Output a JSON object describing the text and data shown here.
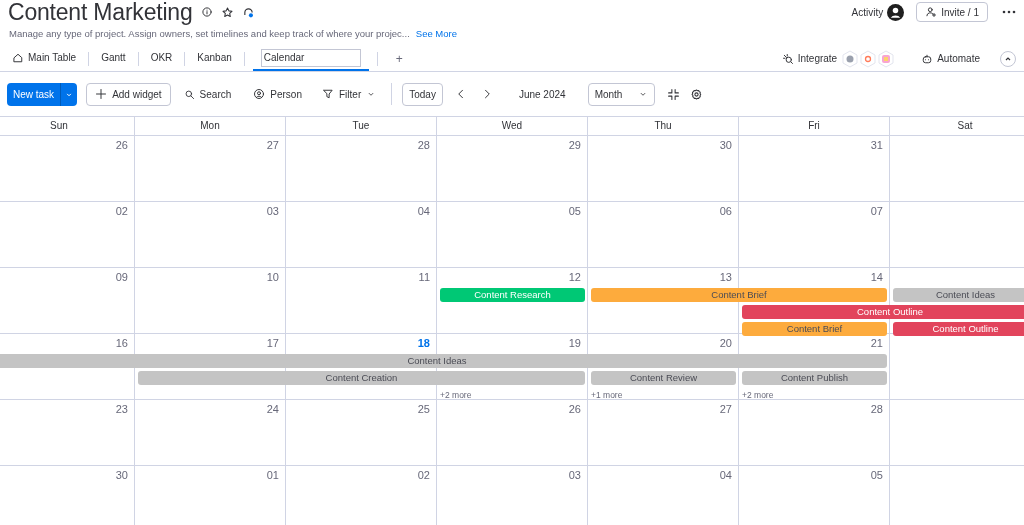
{
  "board": {
    "title": "Content Marketing",
    "description": "Manage any type of project. Assign owners, set timelines and keep track of where your projec...",
    "see_more": "See More",
    "activity": "Activity",
    "invite": "Invite / 1"
  },
  "views": [
    {
      "label": "Main Table",
      "selected": false
    },
    {
      "label": "Gantt",
      "selected": false
    },
    {
      "label": "OKR",
      "selected": false
    },
    {
      "label": "Kanban",
      "selected": false
    },
    {
      "label": "Calendar",
      "selected": true
    }
  ],
  "add_view": "+",
  "apps": {
    "integrate": "Integrate",
    "automate": "Automate"
  },
  "toolbar": {
    "new_task": "New task",
    "add_widget": "Add widget",
    "search": "Search",
    "person": "Person",
    "filter": "Filter",
    "today": "Today",
    "period": "June 2024",
    "view_mode": "Month"
  },
  "calendar": {
    "weekdays": [
      "Sun",
      "Mon",
      "Tue",
      "Wed",
      "Thu",
      "Fri",
      "Sat"
    ],
    "weeks": [
      {
        "days": [
          {
            "date": "26",
            "today": false
          },
          {
            "date": "27",
            "today": false
          },
          {
            "date": "28",
            "today": false
          },
          {
            "date": "29",
            "today": false
          },
          {
            "date": "30",
            "today": false
          },
          {
            "date": "31",
            "today": false
          }
        ]
      },
      {
        "days": [
          {
            "date": "02",
            "today": false
          },
          {
            "date": "03",
            "today": false
          },
          {
            "date": "04",
            "today": false
          },
          {
            "date": "05",
            "today": false
          },
          {
            "date": "06",
            "today": false
          },
          {
            "date": "07",
            "today": false
          }
        ]
      },
      {
        "days": [
          {
            "date": "09",
            "today": false
          },
          {
            "date": "10",
            "today": false
          },
          {
            "date": "11",
            "today": false
          },
          {
            "date": "12",
            "today": false
          },
          {
            "date": "13",
            "today": false
          },
          {
            "date": "14",
            "today": false
          }
        ],
        "lanes": [
          [
            {
              "kind": "empty"
            },
            {
              "kind": "empty"
            },
            {
              "kind": "empty"
            },
            {
              "kind": "bar",
              "label": "Content Research",
              "color": "#00c875"
            },
            {
              "kind": "bar",
              "label": "Content Brief",
              "color": "#fdab3d"
            },
            {
              "kind": "continue"
            },
            {
              "kind": "bar",
              "label": "Content Ideas",
              "color": "#c4c4c4"
            }
          ],
          [
            {
              "kind": "empty"
            },
            {
              "kind": "empty"
            },
            {
              "kind": "empty"
            },
            {
              "kind": "empty"
            },
            {
              "kind": "empty"
            },
            {
              "kind": "bar",
              "label": "Content Outline",
              "color": "#e2445c"
            },
            {
              "kind": "continue"
            }
          ],
          [
            {
              "kind": "empty"
            },
            {
              "kind": "empty"
            },
            {
              "kind": "empty"
            },
            {
              "kind": "empty"
            },
            {
              "kind": "empty"
            },
            {
              "kind": "bar",
              "label": "Content Brief",
              "color": "#fdab3d"
            },
            {
              "kind": "bar",
              "label": "Content Outline",
              "color": "#e2445c"
            }
          ]
        ]
      },
      {
        "days": [
          {
            "date": "16",
            "today": false
          },
          {
            "date": "17",
            "today": false
          },
          {
            "date": "18",
            "today": true
          },
          {
            "date": "19",
            "today": false,
            "more": "+2 more"
          },
          {
            "date": "20",
            "today": false,
            "more": "+1 more"
          },
          {
            "date": "21",
            "today": false,
            "more": "+2 more"
          }
        ],
        "lanes": [
          [
            {
              "kind": "bar",
              "label": "Content Ideas",
              "color": "#c4c4c4"
            },
            {
              "kind": "continue"
            },
            {
              "kind": "continue"
            },
            {
              "kind": "continue"
            },
            {
              "kind": "continue"
            },
            {
              "kind": "continue"
            },
            {
              "kind": "empty"
            }
          ],
          [
            {
              "kind": "empty"
            },
            {
              "kind": "bar",
              "label": "Content Creation",
              "color": "#c4c4c4"
            },
            {
              "kind": "continue"
            },
            {
              "kind": "continue"
            },
            {
              "kind": "bar",
              "label": "Content Review",
              "color": "#c4c4c4"
            },
            {
              "kind": "bar",
              "label": "Content Publish",
              "color": "#c4c4c4"
            },
            {
              "kind": "empty"
            }
          ]
        ]
      },
      {
        "days": [
          {
            "date": "23",
            "today": false
          },
          {
            "date": "24",
            "today": false
          },
          {
            "date": "25",
            "today": false
          },
          {
            "date": "26",
            "today": false
          },
          {
            "date": "27",
            "today": false
          },
          {
            "date": "28",
            "today": false
          }
        ]
      },
      {
        "days": [
          {
            "date": "30",
            "today": false
          },
          {
            "date": "01",
            "today": false
          },
          {
            "date": "02",
            "today": false
          },
          {
            "date": "03",
            "today": false
          },
          {
            "date": "04",
            "today": false
          },
          {
            "date": "05",
            "today": false
          }
        ]
      }
    ]
  }
}
